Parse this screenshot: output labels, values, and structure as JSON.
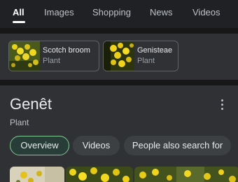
{
  "tabs": [
    {
      "label": "All",
      "active": true
    },
    {
      "label": "Images",
      "active": false
    },
    {
      "label": "Shopping",
      "active": false
    },
    {
      "label": "News",
      "active": false
    },
    {
      "label": "Videos",
      "active": false
    }
  ],
  "entities": [
    {
      "name": "Scotch broom",
      "type": "Plant"
    },
    {
      "name": "Genisteae",
      "type": "Plant"
    }
  ],
  "panel": {
    "title": "Genêt",
    "subtitle": "Plant",
    "chips": [
      {
        "label": "Overview",
        "active": true
      },
      {
        "label": "Videos",
        "active": false
      },
      {
        "label": "People also search for",
        "active": false
      }
    ]
  },
  "colors": {
    "background": "#202124",
    "surface": "#303134",
    "accent_green": "#81c995",
    "active_chip_bg": "#283d37"
  },
  "icons": [
    "more-vert-icon"
  ]
}
